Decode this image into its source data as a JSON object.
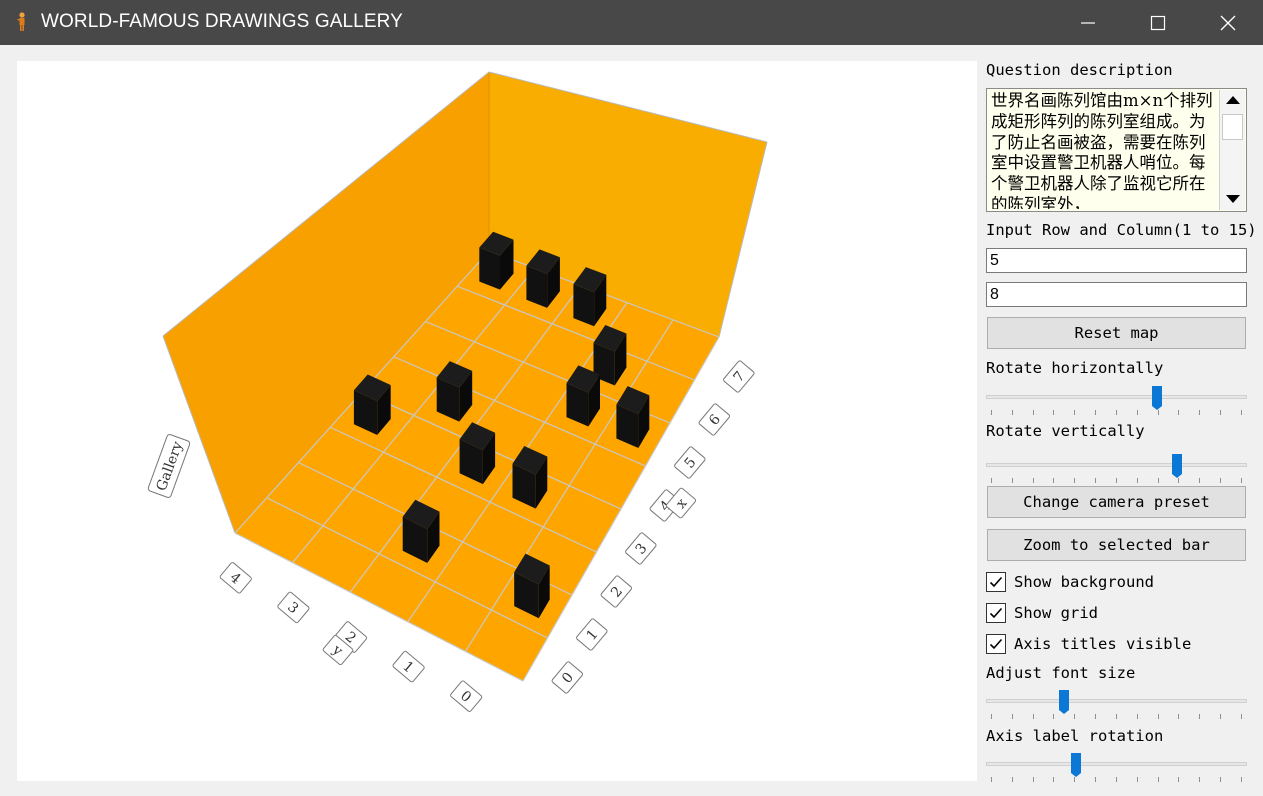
{
  "window": {
    "title": "WORLD-FAMOUS DRAWINGS GALLERY",
    "app_icon": "figure-icon",
    "controls": [
      "minimize-icon",
      "maximize-icon",
      "close-icon"
    ]
  },
  "panel": {
    "question_label": "Question description",
    "question_text": "世界名画陈列馆由m×n个排列成矩形阵列的陈列室组成。为了防止名画被盗，需要在陈列室中设置警卫机器人哨位。每个警卫机器人除了监视它所在的陈列室外，",
    "input_label": "Input Row and Column(1 to 15)",
    "rows_value": "5",
    "columns_value": "8",
    "reset_button": "Reset map",
    "rotate_h_label": "Rotate horizontally",
    "rotate_v_label": "Rotate vertically",
    "camera_button": "Change camera preset",
    "zoom_button": "Zoom to selected bar",
    "show_background_label": "Show background",
    "show_background_checked": true,
    "show_grid_label": "Show grid",
    "show_grid_checked": true,
    "axis_titles_label": "Axis titles visible",
    "axis_titles_checked": true,
    "font_size_label": "Adjust font size",
    "axis_rotation_label": "Axis label rotation",
    "sliders": {
      "rotate_horizontally": 0.66,
      "rotate_vertically": 0.74,
      "font_size": 0.29,
      "axis_label_rotation": 0.34
    }
  },
  "chart_data": {
    "type": "bar3d",
    "rows": 5,
    "columns": 8,
    "x_axis_title": "x",
    "y_axis_title": "y",
    "z_axis_title": "Gallery",
    "x_tick_labels": [
      "0",
      "1",
      "2",
      "3",
      "4",
      "5",
      "6",
      "7"
    ],
    "y_tick_labels": [
      "0",
      "1",
      "2",
      "3",
      "4"
    ],
    "robot_positions": [
      {
        "row": 0,
        "col": 1
      },
      {
        "row": 1,
        "col": 3
      },
      {
        "row": 2,
        "col": 3
      },
      {
        "row": 3,
        "col": 4
      },
      {
        "row": 4,
        "col": 3
      },
      {
        "row": 1,
        "col": 5
      },
      {
        "row": 2,
        "col": 7
      },
      {
        "row": 3,
        "col": 7
      },
      {
        "row": 1,
        "col": 6
      },
      {
        "row": 2,
        "col": 1
      },
      {
        "row": 4,
        "col": 7
      },
      {
        "row": 0,
        "col": 5
      }
    ],
    "grid": true,
    "background": true,
    "floor_color": "#ffa500",
    "wall_color": "#f9a800",
    "bar_color": "#000000"
  }
}
